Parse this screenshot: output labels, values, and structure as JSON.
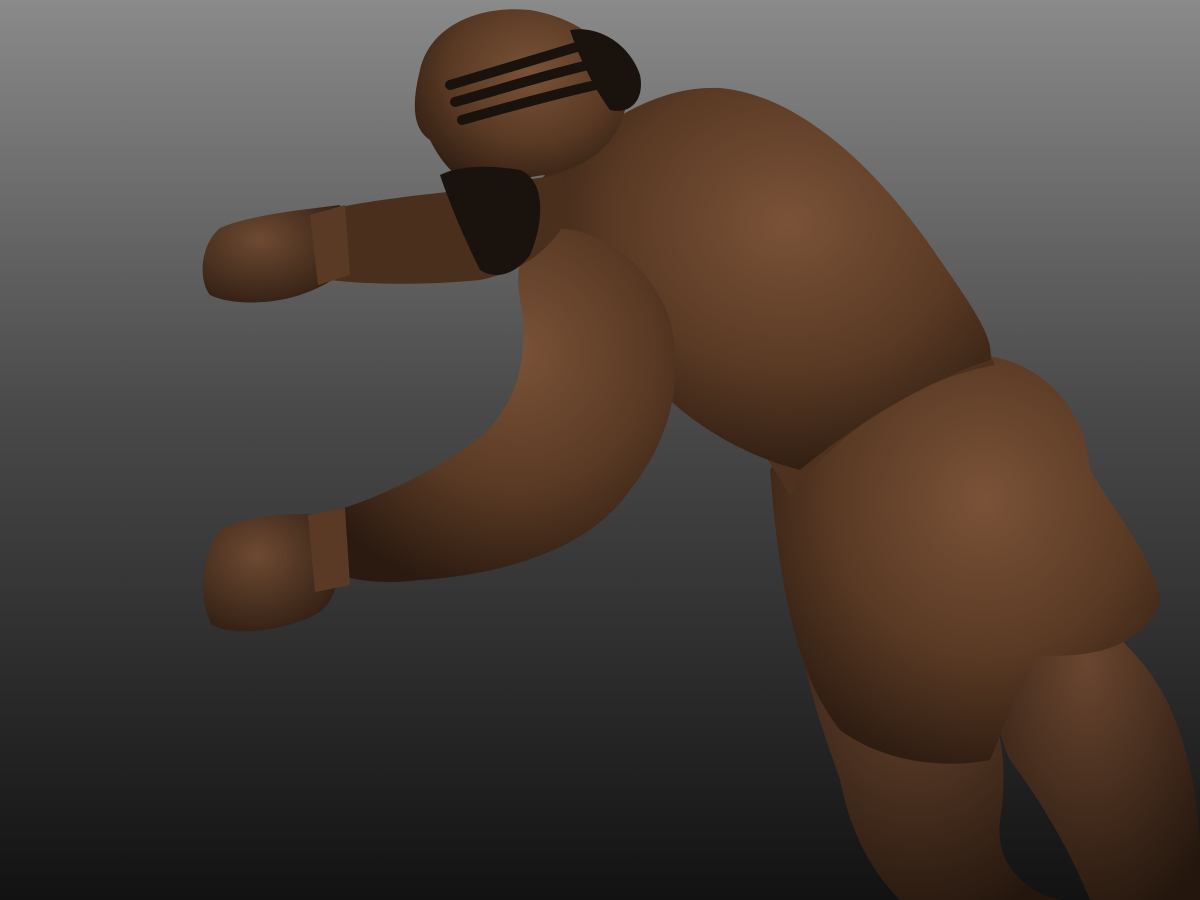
{
  "viewport": {
    "background_top": "#8a8a8a",
    "background_bottom": "#121212"
  },
  "model": {
    "material_color": "#5a3a24",
    "highlight_color": "#7a5238",
    "shadow_color": "#2a1a10",
    "hair_color": "#1a120c"
  }
}
